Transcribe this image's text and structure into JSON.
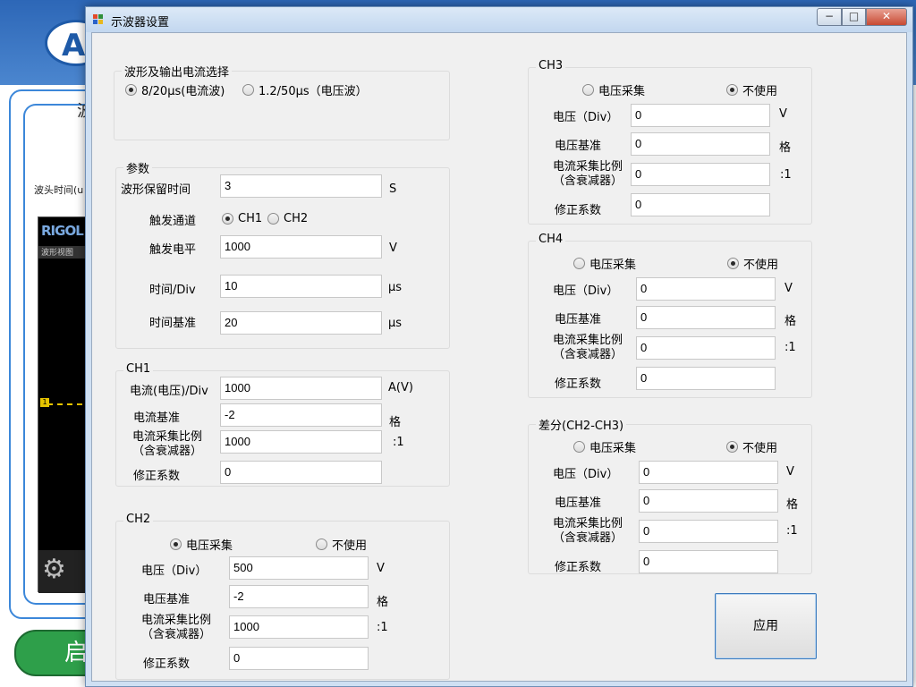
{
  "background": {
    "logo_letter": "A",
    "tab_char": "波",
    "label_wave_head": "波头时间(u",
    "scope_brand": "RIGOL",
    "scope_subtitle": "波形视图",
    "trace_marker": "1",
    "start_button_char": "启"
  },
  "window": {
    "title": "示波器设置",
    "minimize_symbol": "−",
    "maximize_symbol": "□",
    "close_symbol": "✕"
  },
  "waveform_group": {
    "title": "波形及输出电流选择",
    "options": [
      {
        "label": "8/20μs(电流波)",
        "selected": true
      },
      {
        "label": "1.2/50μs（电压波）",
        "selected": false
      }
    ]
  },
  "params": {
    "title": "参数",
    "hold_time_label": "波形保留时间",
    "hold_time_value": "3",
    "hold_time_unit": "S",
    "trigger_channel_label": "触发通道",
    "trigger_options": [
      {
        "label": "CH1",
        "selected": true
      },
      {
        "label": "CH2",
        "selected": false
      }
    ],
    "trigger_level_label": "触发电平",
    "trigger_level_value": "1000",
    "trigger_level_unit": "V",
    "time_div_label": "时间/Div",
    "time_div_value": "10",
    "time_div_unit": "μs",
    "time_base_label": "时间基准",
    "time_base_value": "20",
    "time_base_unit": "μs"
  },
  "ch1": {
    "title": "CH1",
    "current_div_label": "电流(电压)/Div",
    "current_div_value": "1000",
    "current_div_unit": "A(V)",
    "current_base_label": "电流基准",
    "current_base_value": "-2",
    "current_base_unit": "格",
    "ratio_label_1": "电流采集比例",
    "ratio_label_2": "（含衰减器）",
    "ratio_value": "1000",
    "ratio_unit": ":1",
    "correction_label": "修正系数",
    "correction_value": "0"
  },
  "ch2": {
    "title": "CH2",
    "opt_collect": "电压采集",
    "opt_unused": "不使用",
    "collect_selected": true,
    "voltage_div_label": "电压（Div）",
    "voltage_div_value": "500",
    "voltage_div_unit": "V",
    "voltage_base_label": "电压基准",
    "voltage_base_value": "-2",
    "voltage_base_unit": "格",
    "ratio_label_1": "电流采集比例",
    "ratio_label_2": "（含衰减器）",
    "ratio_value": "1000",
    "ratio_unit": ":1",
    "correction_label": "修正系数",
    "correction_value": "0"
  },
  "ch3": {
    "title": "CH3",
    "opt_collect": "电压采集",
    "opt_unused": "不使用",
    "collect_selected": false,
    "voltage_div_label": "电压（Div）",
    "voltage_div_value": "0",
    "voltage_div_unit": "V",
    "voltage_base_label": "电压基准",
    "voltage_base_value": "0",
    "voltage_base_unit": "格",
    "ratio_label_1": "电流采集比例",
    "ratio_label_2": "（含衰减器）",
    "ratio_value": "0",
    "ratio_unit": ":1",
    "correction_label": "修正系数",
    "correction_value": "0"
  },
  "ch4": {
    "title": "CH4",
    "opt_collect": "电压采集",
    "opt_unused": "不使用",
    "collect_selected": false,
    "voltage_div_label": "电压（Div）",
    "voltage_div_value": "0",
    "voltage_div_unit": "V",
    "voltage_base_label": "电压基准",
    "voltage_base_value": "0",
    "voltage_base_unit": "格",
    "ratio_label_1": "电流采集比例",
    "ratio_label_2": "（含衰减器）",
    "ratio_value": "0",
    "ratio_unit": ":1",
    "correction_label": "修正系数",
    "correction_value": "0"
  },
  "diff": {
    "title": "差分(CH2-CH3)",
    "opt_collect": "电压采集",
    "opt_unused": "不使用",
    "collect_selected": false,
    "voltage_div_label": "电压（Div）",
    "voltage_div_value": "0",
    "voltage_div_unit": "V",
    "voltage_base_label": "电压基准",
    "voltage_base_value": "0",
    "voltage_base_unit": "格",
    "ratio_label_1": "电流采集比例",
    "ratio_label_2": "（含衰减器）",
    "ratio_value": "0",
    "ratio_unit": ":1",
    "correction_label": "修正系数",
    "correction_value": "0"
  },
  "apply_label": "应用"
}
